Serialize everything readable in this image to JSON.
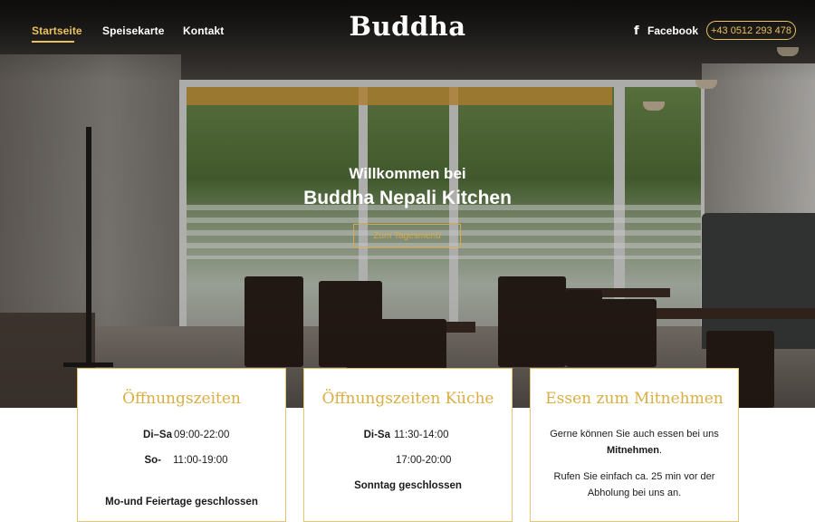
{
  "nav": {
    "links": [
      {
        "label": "Startseite",
        "active": true
      },
      {
        "label": "Speisekarte",
        "active": false
      },
      {
        "label": "Kontakt",
        "active": false
      }
    ],
    "brand": "Buddha",
    "facebook_label": "Facebook",
    "phone": "+43 0512 293 478"
  },
  "hero": {
    "line1": "Willkommen bei",
    "line2": "Buddha Nepali Kitchen",
    "button_label": "Zum Tagesmenü"
  },
  "cards": {
    "hours": {
      "title": "Öffnungszeiten",
      "rows": [
        {
          "day": "Di–Sa",
          "time": "09:00-22:00"
        },
        {
          "day": "So-",
          "time": "11:00-19:00"
        }
      ],
      "note": "Mo-und Feiertage geschlossen"
    },
    "kitchen": {
      "title": "Öffnungszeiten Küche",
      "rows": [
        {
          "day": "Di-Sa",
          "time": "11:30-14:00"
        },
        {
          "day": "",
          "time": "17:00-20:00"
        }
      ],
      "note": "Sonntag geschlossen"
    },
    "takeaway": {
      "title": "Essen zum Mitnehmen",
      "para1_pre": "Gerne können Sie auch essen bei uns",
      "para1_bold": "Mitnehmen",
      "para1_post": ".",
      "para2": "Rufen Sie einfach ca. 25 min vor der Abholung bei uns an."
    }
  },
  "colors": {
    "accent": "#e8c25c",
    "card_title": "#d9ae44",
    "card_border": "#e4c670"
  },
  "icons": {
    "facebook": "facebook-icon"
  }
}
